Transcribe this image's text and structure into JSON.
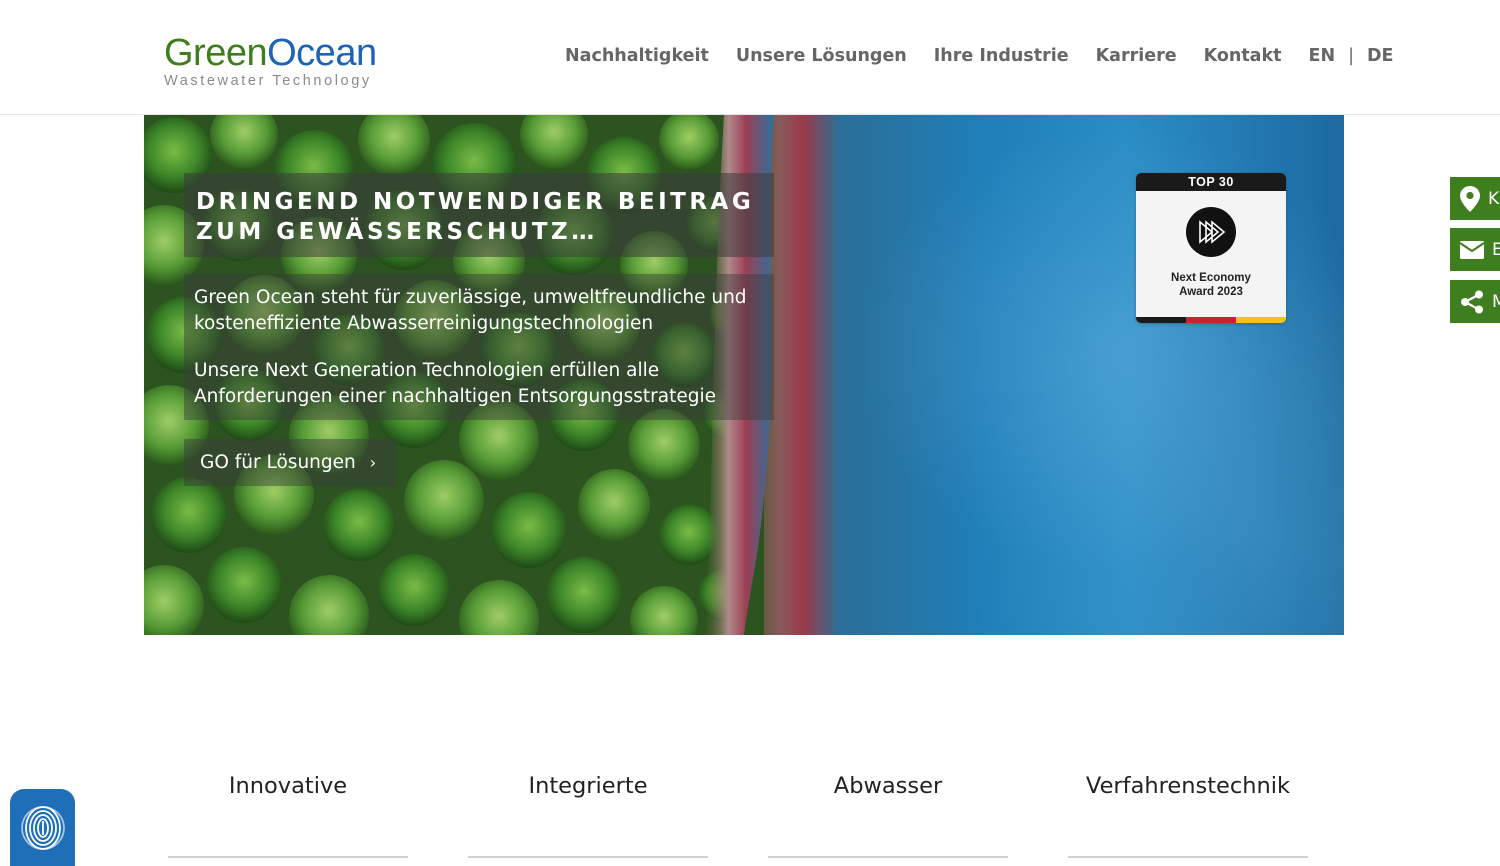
{
  "header": {
    "logo": {
      "green": "Green",
      "blue": "Ocean",
      "tagline": "Wastewater Technology"
    },
    "nav": [
      "Nachhaltigkeit",
      "Unsere Lösungen",
      "Ihre Industrie",
      "Karriere",
      "Kontakt"
    ],
    "languages": {
      "en": "EN",
      "separator": "|",
      "de": "DE"
    }
  },
  "hero": {
    "headline": "DRINGEND NOTWENDIGER BEITRAG ZUM GEWÄSSERSCHUTZ…",
    "paragraph1": "Green Ocean steht für zuverlässige, umweltfreundliche und kosteneffiziente Abwasserreinigungstechnologien",
    "paragraph2": "Unsere Next Generation Technologien erfüllen alle Anforderungen einer nachhaltigen Entsorgungsstrategie",
    "cta_label": "GO für Lösungen",
    "cta_chevron": "›"
  },
  "award": {
    "top_label": "TOP 30",
    "line1": "Next Economy",
    "line2": "Award 2023",
    "flag_colors": [
      "#1a1a1a",
      "#d0202e",
      "#f1c40f"
    ]
  },
  "side_buttons": [
    {
      "icon": "location-pin-icon",
      "label": "K"
    },
    {
      "icon": "envelope-icon",
      "label": "E"
    },
    {
      "icon": "share-icon",
      "label": "M"
    }
  ],
  "tabs": [
    "Innovative",
    "Integrierte",
    "Abwasser",
    "Verfahrenstechnik"
  ],
  "colors": {
    "brand_green": "#3f7e1f",
    "brand_blue": "#1c63b7",
    "privacy_blue": "#1f6fb8"
  }
}
